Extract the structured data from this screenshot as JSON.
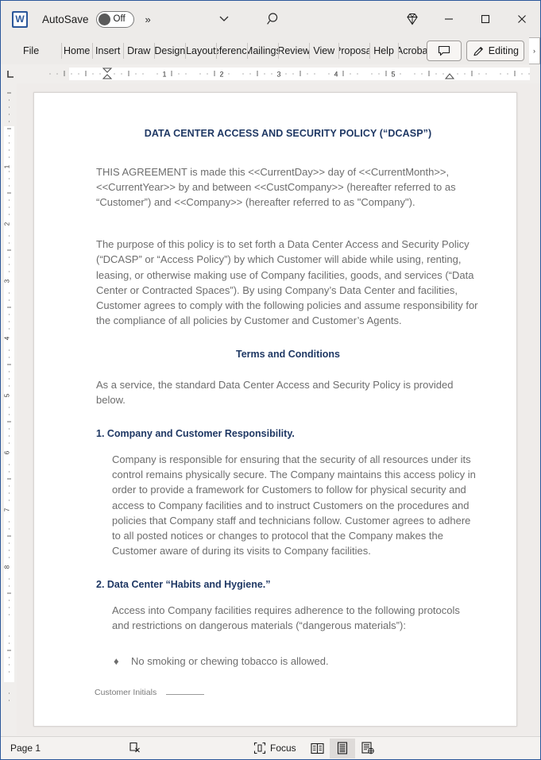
{
  "titlebar": {
    "app_logo": "word-logo",
    "app_logo_letter": "W",
    "autosave_label": "AutoSave",
    "autosave_state": "Off",
    "more_commands": "»",
    "ribbon_display_options_icon": "chevron-down-icon",
    "search_icon": "search-icon",
    "premium_icon": "diamond-icon",
    "minimize_label": "–",
    "maximize_label": "☐",
    "close_label": "✕"
  },
  "ribbon": {
    "tabs": [
      {
        "label": "File"
      },
      {
        "label": "Home"
      },
      {
        "label": "Insert"
      },
      {
        "label": "Draw"
      },
      {
        "label": "Design"
      },
      {
        "label": "Layout"
      },
      {
        "label": "References"
      },
      {
        "label": "Mailings"
      },
      {
        "label": "Review"
      },
      {
        "label": "View"
      },
      {
        "label": "Proposal"
      },
      {
        "label": "Help"
      },
      {
        "label": "Acrobat"
      }
    ],
    "comments_label": "",
    "comments_icon": "comment-icon",
    "editing_label": "Editing",
    "editing_icon": "pencil-icon",
    "overflow_caret": "›"
  },
  "ruler": {
    "tabstop_icon": "tab-stop-left-icon",
    "horizontal_marks": [
      "1",
      "2",
      "3",
      "4",
      "5"
    ],
    "vertical_marks": [
      "1",
      "2",
      "3",
      "4",
      "5",
      "6",
      "7",
      "8"
    ]
  },
  "document": {
    "title": "DATA CENTER ACCESS AND SECURITY POLICY (“DCASP”)",
    "paragraph_1": "THIS AGREEMENT is made this <<CurrentDay>> day of <<CurrentMonth>>, <<CurrentYear>> by and between <<CustCompany>> (hereafter referred to as “Customer”) and <<Company>> (hereafter referred to as \"Company\").",
    "paragraph_2": "The purpose of this policy is to set forth a Data Center Access and Security Policy (“DCASP” or “Access Policy”) by which Customer will abide while using, renting, leasing, or otherwise making use of Company facilities, goods, and services (“Data Center or Contracted Spaces”). By using Company’s Data Center and facilities, Customer agrees to comply with the following policies and assume responsibility for the compliance of all policies by Customer and Customer’s Agents.",
    "terms_heading": "Terms and Conditions",
    "terms_intro": "As a service, the standard Data Center Access and Security Policy is provided below.",
    "section_1_heading": "1. Company and Customer Responsibility.",
    "section_1_body": "Company is responsible for ensuring that the security of all resources under its control remains physically secure. The Company maintains this access policy in order to provide a framework for Customers to follow for physical security and access to Company facilities and to instruct Customers on the procedures and policies that Company staff and technicians follow. Customer agrees to adhere to all posted notices or changes to protocol that the Company makes the Customer aware of during its visits to Company facilities.",
    "section_2_heading": "2. Data Center “Habits and Hygiene.”",
    "section_2_body": "Access into Company facilities requires adherence to the following protocols and restrictions on dangerous materials (“dangerous materials”):",
    "bullet_mark": "♦",
    "bullet_1": "No smoking or chewing tobacco is allowed.",
    "footer_initials_label": "Customer Initials",
    "heading_color": "#1f3864",
    "body_color": "#6d6d6d"
  },
  "statusbar": {
    "page_label": "Page 1",
    "proofing_icon": "proofing-errors-icon",
    "focus_label": "Focus",
    "focus_icon": "focus-icon",
    "read_mode_icon": "read-mode-icon",
    "print_layout_icon": "print-layout-icon",
    "web_layout_icon": "web-layout-icon"
  }
}
